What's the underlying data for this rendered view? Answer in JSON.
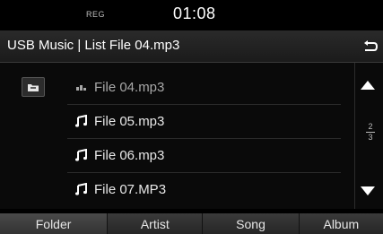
{
  "status": {
    "reg": "REG",
    "time": "01:08"
  },
  "header": {
    "title": "USB Music | List   File 04.mp3",
    "back_icon": "back-return-icon"
  },
  "list": {
    "folder_icon": "folder-icon",
    "items": [
      {
        "label": "File 04.mp3",
        "icon": "playing-bars-icon",
        "current": true
      },
      {
        "label": "File 05.mp3",
        "icon": "music-note-icon"
      },
      {
        "label": "File 06.mp3",
        "icon": "music-note-icon"
      },
      {
        "label": "File 07.MP3",
        "icon": "music-note-icon"
      }
    ]
  },
  "scroll": {
    "page_current": "2",
    "page_total": "3"
  },
  "tabs": [
    {
      "label": "Folder",
      "active": true
    },
    {
      "label": "Artist"
    },
    {
      "label": "Song"
    },
    {
      "label": "Album"
    }
  ]
}
